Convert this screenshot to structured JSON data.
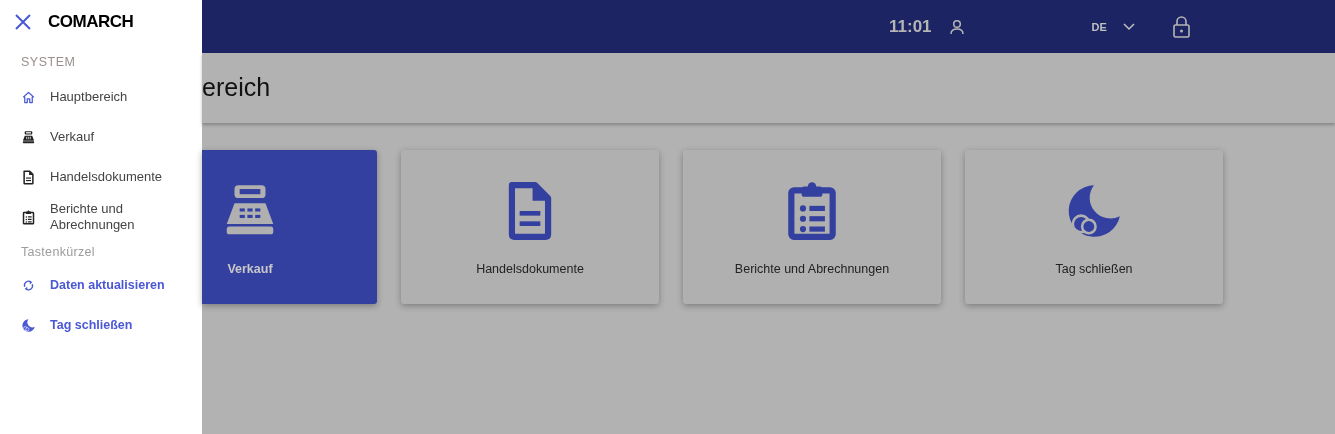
{
  "drawer": {
    "logo": "COMARCH",
    "sections": [
      {
        "title": "SYSTEM",
        "kind": "system",
        "items": [
          {
            "label": "Hauptbereich",
            "kind": "home"
          },
          {
            "label": "Verkauf",
            "kind": "register"
          },
          {
            "label": "Handelsdokumente",
            "kind": "document"
          },
          {
            "label": "Berichte und Abrechnungen",
            "kind": "clipboard"
          }
        ]
      },
      {
        "title": "Tastenkürzel",
        "kind": "shortcut",
        "items": [
          {
            "label": "Daten aktualisieren",
            "kind": "sync"
          },
          {
            "label": "Tag schließen",
            "kind": "moon"
          }
        ]
      }
    ]
  },
  "header": {
    "time": "11:01",
    "language": "DE"
  },
  "page_title": "ereich",
  "tiles": [
    {
      "label": "Verkauf",
      "kind": "register",
      "selected": true
    },
    {
      "label": "Handelsdokumente",
      "kind": "document",
      "selected": false
    },
    {
      "label": "Berichte und Abrechnungen",
      "kind": "clipboard",
      "selected": false
    },
    {
      "label": "Tag schließen",
      "kind": "moon",
      "selected": false
    }
  ]
}
